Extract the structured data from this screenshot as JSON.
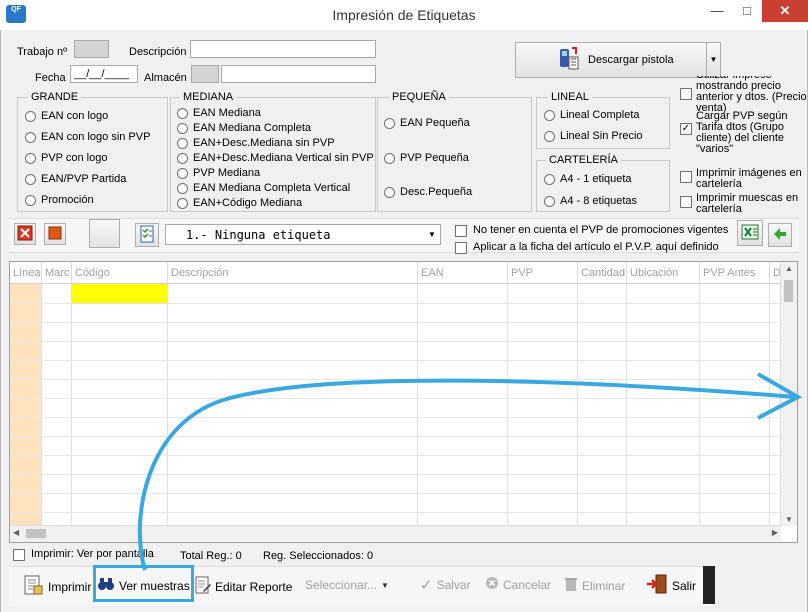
{
  "window": {
    "title": "Impresión de Etiquetas",
    "icon_text": "QF"
  },
  "header": {
    "trabajo_label": "Trabajo nº",
    "descripcion_label": "Descripción",
    "fecha_label": "Fecha",
    "fecha_value": "__/__/____",
    "almacen_label": "Almacén",
    "descargar_label": "Descargar pistola"
  },
  "groups": {
    "grande": {
      "title": "GRANDE",
      "options": [
        "EAN con logo",
        "EAN con logo sin PVP",
        "PVP con logo",
        "EAN/PVP Partida",
        "Promoción"
      ]
    },
    "mediana": {
      "title": "MEDIANA",
      "options": [
        "EAN Mediana",
        "EAN Mediana Completa",
        "EAN+Desc.Mediana sin PVP",
        "EAN+Desc.Mediana Vertical sin PVP",
        "PVP Mediana",
        "EAN Mediana Completa Vertical",
        "EAN+Código Mediana"
      ]
    },
    "pequena": {
      "title": "PEQUEÑA",
      "options": [
        "EAN Pequeña",
        "PVP Pequeña",
        "Desc.Pequeña"
      ]
    },
    "lineal": {
      "title": "LINEAL",
      "options": [
        "Lineal Completa",
        "Lineal Sin Precio"
      ]
    },
    "carteleria": {
      "title": "CARTELERÍA",
      "options": [
        "A4 - 1 etiqueta",
        "A4 - 8 etiquetas"
      ]
    }
  },
  "right_options": {
    "opt1": "Utilizar impreso mostrando precio anterior y dtos. (Precio venta)",
    "opt2": "Cargar PVP según Tarifa dtos (Grupo cliente) del cliente \"varios\"",
    "opt3": "Imprimir imágenes en cartelería",
    "opt4": "Imprimir muescas en cartelería"
  },
  "etiqueta_select": {
    "value": "1.- Ninguna etiqueta"
  },
  "checks": {
    "no_tener": "No tener en cuenta el PVP de promociones vigentes",
    "aplicar": "Aplicar a la ficha del artículo el P.V.P. aquí definido"
  },
  "grid": {
    "columns": [
      "Línea",
      "Marc",
      "Código",
      "Descripción",
      "EAN",
      "PVP",
      "Cantidad",
      "Ubicación",
      "PVP Antes",
      "D"
    ]
  },
  "status": {
    "imprimir_ver": "Imprimir: Ver por pantalla",
    "total_reg": "Total Reg.: 0",
    "reg_sel": "Reg. Seleccionados: 0"
  },
  "toolbar": {
    "imprimir": "Imprimir",
    "ver_muestras": "Ver muestras",
    "editar_reporte": "Editar Reporte",
    "seleccionar": "Seleccionar...",
    "salvar": "Salvar",
    "cancelar": "Cancelar",
    "eliminar": "Eliminar",
    "salir": "Salir"
  },
  "colors": {
    "accent": "#3aa8e0",
    "close": "#c84031",
    "highlight_cell": "#ffff00",
    "line_column": "#fde2bd"
  }
}
